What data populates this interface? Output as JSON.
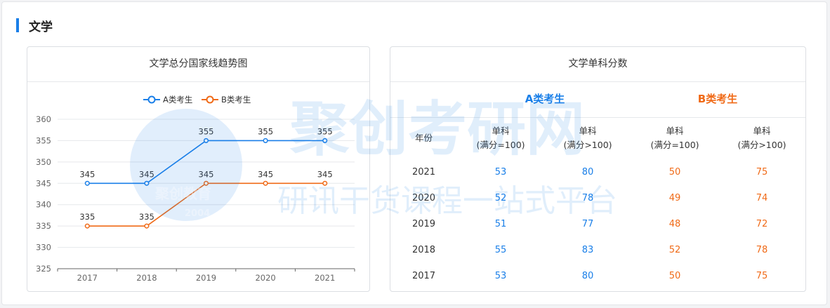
{
  "section": {
    "title": "文学"
  },
  "chart_card": {
    "title": "文学总分国家线趋势图"
  },
  "table_card": {
    "title": "文学单科分数",
    "group_a": "A类考生",
    "group_b": "B类考生",
    "headers": {
      "year": "年份",
      "a_single_100": [
        "单科",
        "(满分=100)"
      ],
      "a_single_gt100": [
        "单科",
        "(满分>100)"
      ],
      "b_single_100": [
        "单科",
        "(满分=100)"
      ],
      "b_single_gt100": [
        "单科",
        "(满分>100)"
      ]
    },
    "rows": [
      {
        "year": "2021",
        "a100": "53",
        "a_gt100": "80",
        "b100": "50",
        "b_gt100": "75"
      },
      {
        "year": "2020",
        "a100": "52",
        "a_gt100": "78",
        "b100": "49",
        "b_gt100": "74"
      },
      {
        "year": "2019",
        "a100": "51",
        "a_gt100": "77",
        "b100": "48",
        "b_gt100": "72"
      },
      {
        "year": "2018",
        "a100": "55",
        "a_gt100": "83",
        "b100": "52",
        "b_gt100": "78"
      },
      {
        "year": "2017",
        "a100": "53",
        "a_gt100": "80",
        "b100": "50",
        "b_gt100": "75"
      }
    ]
  },
  "watermark": {
    "brand": "聚创考研网",
    "slogan": "研讯干货课程一站式平台",
    "logo_text": "聚创教育",
    "logo_year": "2004"
  },
  "colors": {
    "accent": "#1a7fe8",
    "series_a": "#1a7fe8",
    "series_b": "#f06a17"
  },
  "chart_data": {
    "type": "line",
    "title": "",
    "categories": [
      "2017",
      "2018",
      "2019",
      "2020",
      "2021"
    ],
    "series": [
      {
        "name": "A类考生",
        "color": "#1a7fe8",
        "values": [
          345,
          345,
          355,
          355,
          355
        ]
      },
      {
        "name": "B类考生",
        "color": "#f06a17",
        "values": [
          335,
          335,
          345,
          345,
          345
        ]
      }
    ],
    "yticks": [
      325,
      330,
      335,
      340,
      345,
      350,
      355,
      360
    ],
    "ylim": [
      325,
      360
    ],
    "grid": true,
    "legend": "top",
    "data_labels": true
  }
}
